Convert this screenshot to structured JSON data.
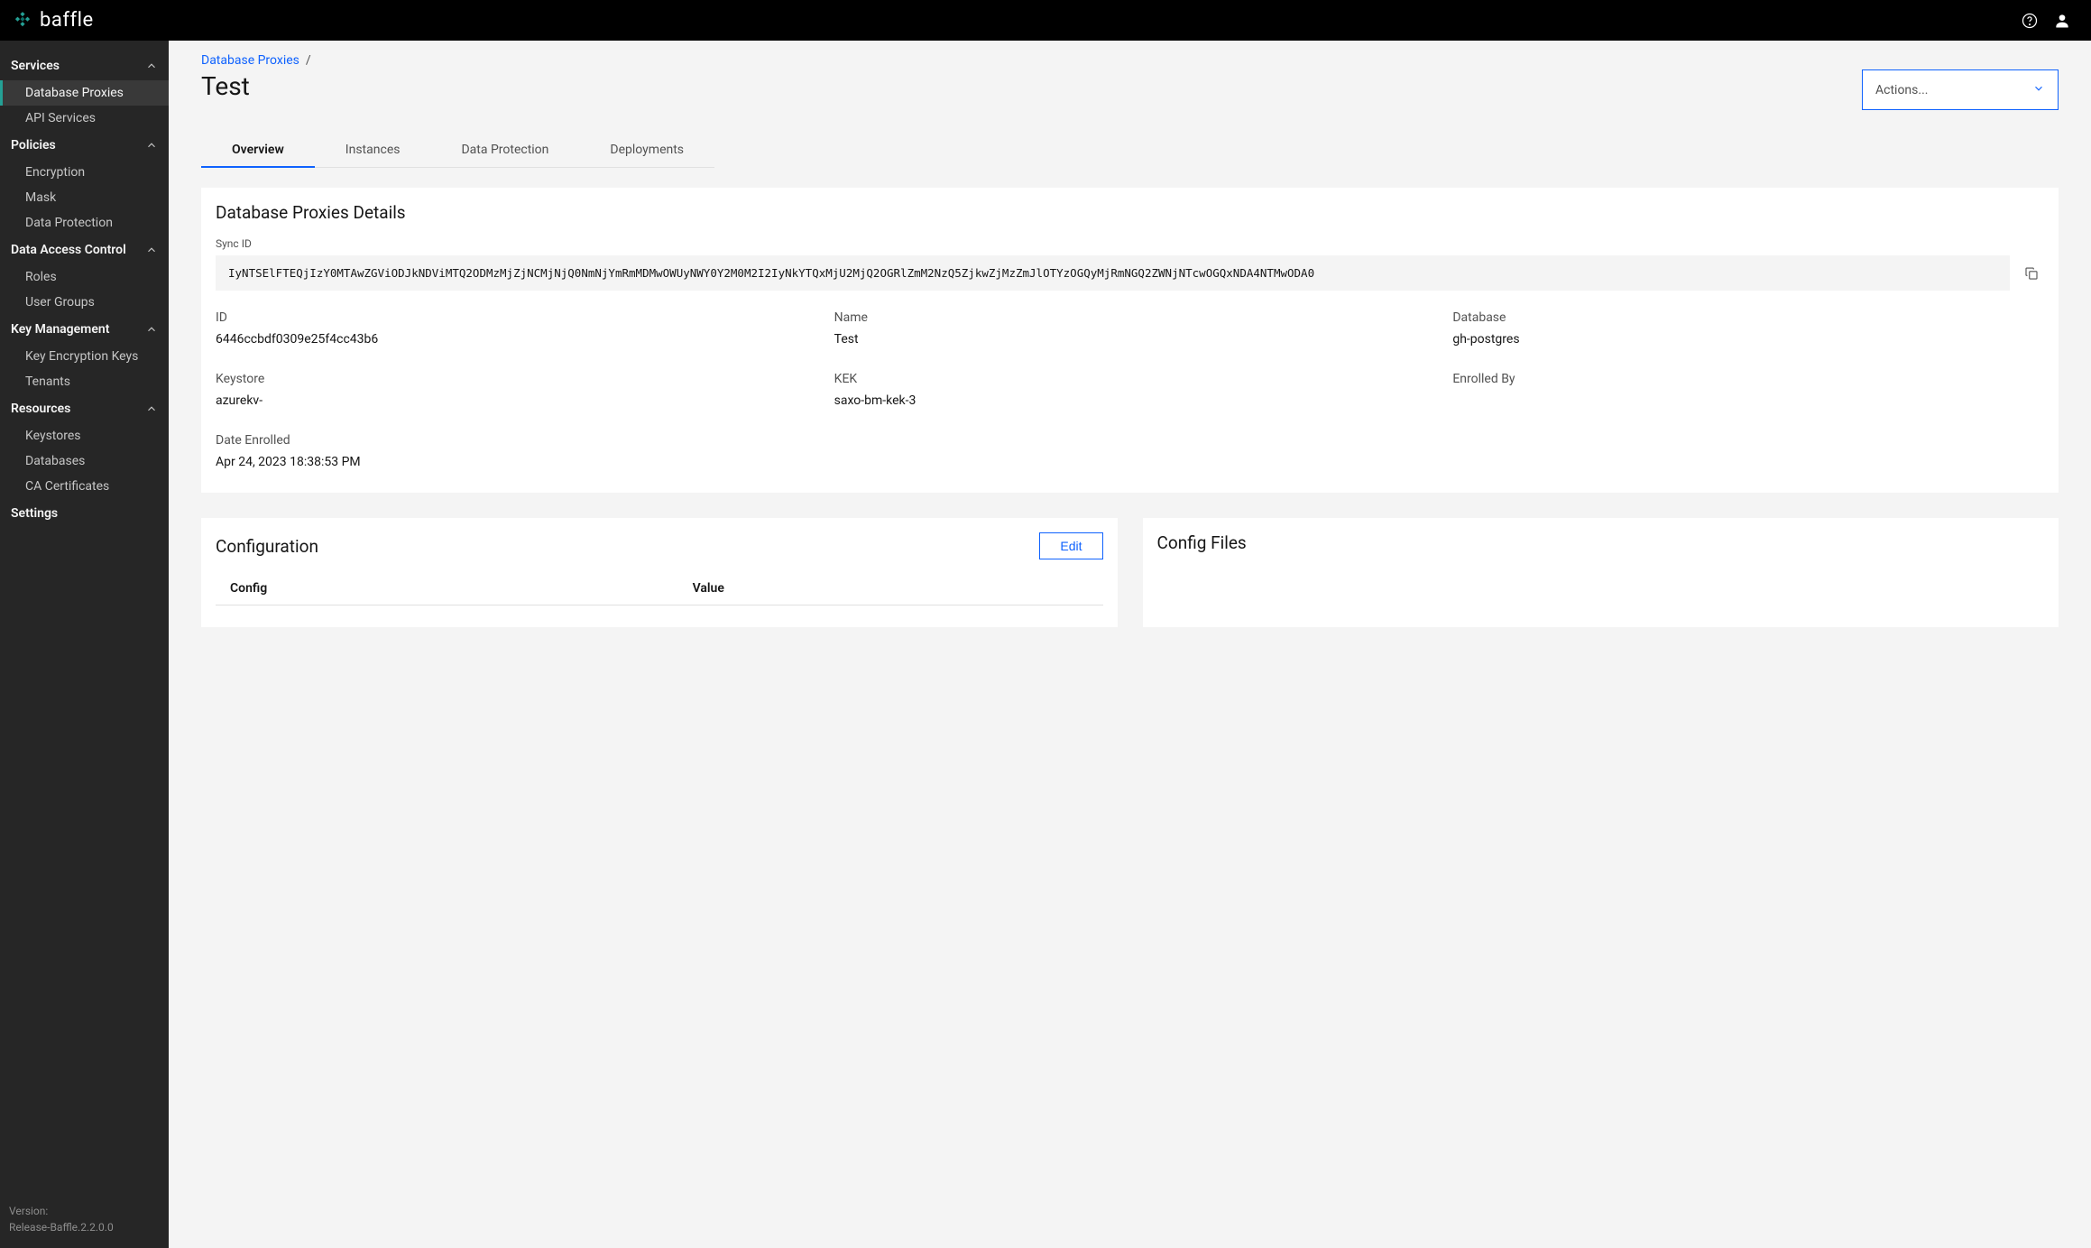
{
  "brand": {
    "name": "baffle"
  },
  "sidebar": {
    "sections": [
      {
        "label": "Services",
        "items": [
          {
            "label": "Database Proxies",
            "active": true
          },
          {
            "label": "API Services"
          }
        ]
      },
      {
        "label": "Policies",
        "items": [
          {
            "label": "Encryption"
          },
          {
            "label": "Mask"
          },
          {
            "label": "Data Protection"
          }
        ]
      },
      {
        "label": "Data Access Control",
        "items": [
          {
            "label": "Roles"
          },
          {
            "label": "User Groups"
          }
        ]
      },
      {
        "label": "Key Management",
        "items": [
          {
            "label": "Key Encryption Keys"
          },
          {
            "label": "Tenants"
          }
        ]
      },
      {
        "label": "Resources",
        "items": [
          {
            "label": "Keystores"
          },
          {
            "label": "Databases"
          },
          {
            "label": "CA Certificates"
          }
        ]
      }
    ],
    "settings_label": "Settings",
    "version_label": "Version:",
    "version": "Release-Baffle.2.2.0.0"
  },
  "breadcrumb": {
    "parent": "Database Proxies",
    "sep": "/"
  },
  "page_title": "Test",
  "actions_label": "Actions...",
  "tabs": [
    {
      "label": "Overview",
      "active": true
    },
    {
      "label": "Instances"
    },
    {
      "label": "Data Protection"
    },
    {
      "label": "Deployments"
    }
  ],
  "details": {
    "title": "Database Proxies Details",
    "sync_label": "Sync ID",
    "sync_value": "IyNTSElFTEQjIzY0MTAwZGViODJkNDViMTQ2ODMzMjZjNCMjNjQ0NmNjYmRmMDMwOWUyNWY0Y2M0M2I2IyNkYTQxMjU2MjQ2OGRlZmM2NzQ5ZjkwZjMzZmJlOTYzOGQyMjRmNGQ2ZWNjNTcwOGQxNDA4NTMwODA0",
    "fields": {
      "id": {
        "label": "ID",
        "value": "6446ccbdf0309e25f4cc43b6"
      },
      "name": {
        "label": "Name",
        "value": "Test"
      },
      "database": {
        "label": "Database",
        "value": "gh-postgres"
      },
      "keystore": {
        "label": "Keystore",
        "value": "azurekv-"
      },
      "kek": {
        "label": "KEK",
        "value": "saxo-bm-kek-3"
      },
      "enrolled_by": {
        "label": "Enrolled By",
        "value": ""
      },
      "date_enrolled": {
        "label": "Date Enrolled",
        "value": "Apr 24, 2023 18:38:53 PM"
      }
    }
  },
  "configuration": {
    "title": "Configuration",
    "edit_label": "Edit",
    "columns": {
      "config": "Config",
      "value": "Value"
    }
  },
  "config_files": {
    "title": "Config Files"
  }
}
